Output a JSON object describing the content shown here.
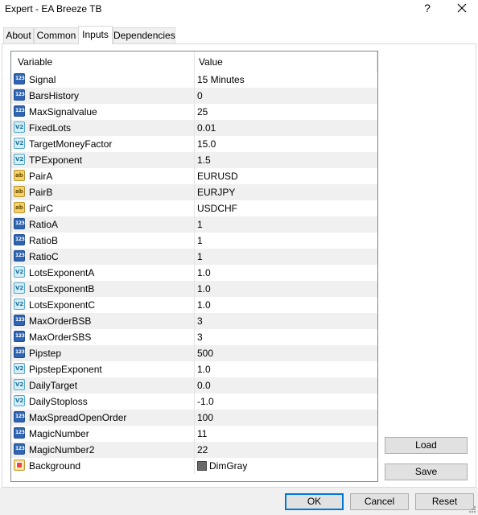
{
  "window": {
    "title": "Expert - EA Breeze TB",
    "help_glyph": "?"
  },
  "tabs": [
    {
      "label": "About",
      "active": false
    },
    {
      "label": "Common",
      "active": false
    },
    {
      "label": "Inputs",
      "active": true
    },
    {
      "label": "Dependencies",
      "active": false
    }
  ],
  "grid": {
    "columns": {
      "variable": "Variable",
      "value": "Value"
    },
    "rows": [
      {
        "type": "int",
        "icon": "int-type-icon",
        "name": "Signal",
        "value": "15 Minutes"
      },
      {
        "type": "int",
        "icon": "int-type-icon",
        "name": "BarsHistory",
        "value": "0"
      },
      {
        "type": "int",
        "icon": "int-type-icon",
        "name": "MaxSignalvalue",
        "value": "25"
      },
      {
        "type": "double",
        "icon": "double-type-icon",
        "name": "FixedLots",
        "value": "0.01"
      },
      {
        "type": "double",
        "icon": "double-type-icon",
        "name": "TargetMoneyFactor",
        "value": "15.0"
      },
      {
        "type": "double",
        "icon": "double-type-icon",
        "name": "TPExponent",
        "value": "1.5"
      },
      {
        "type": "string",
        "icon": "string-type-icon",
        "name": "PairA",
        "value": "EURUSD"
      },
      {
        "type": "string",
        "icon": "string-type-icon",
        "name": "PairB",
        "value": "EURJPY"
      },
      {
        "type": "string",
        "icon": "string-type-icon",
        "name": "PairC",
        "value": "USDCHF"
      },
      {
        "type": "int",
        "icon": "int-type-icon",
        "name": "RatioA",
        "value": "1"
      },
      {
        "type": "int",
        "icon": "int-type-icon",
        "name": "RatioB",
        "value": "1"
      },
      {
        "type": "int",
        "icon": "int-type-icon",
        "name": "RatioC",
        "value": "1"
      },
      {
        "type": "double",
        "icon": "double-type-icon",
        "name": "LotsExponentA",
        "value": "1.0"
      },
      {
        "type": "double",
        "icon": "double-type-icon",
        "name": "LotsExponentB",
        "value": "1.0"
      },
      {
        "type": "double",
        "icon": "double-type-icon",
        "name": "LotsExponentC",
        "value": "1.0"
      },
      {
        "type": "int",
        "icon": "int-type-icon",
        "name": "MaxOrderBSB",
        "value": "3"
      },
      {
        "type": "int",
        "icon": "int-type-icon",
        "name": "MaxOrderSBS",
        "value": "3"
      },
      {
        "type": "int",
        "icon": "int-type-icon",
        "name": "Pipstep",
        "value": "500"
      },
      {
        "type": "double",
        "icon": "double-type-icon",
        "name": "PipstepExponent",
        "value": "1.0"
      },
      {
        "type": "double",
        "icon": "double-type-icon",
        "name": "DailyTarget",
        "value": "0.0"
      },
      {
        "type": "double",
        "icon": "double-type-icon",
        "name": "DailyStoploss",
        "value": "-1.0"
      },
      {
        "type": "int",
        "icon": "int-type-icon",
        "name": "MaxSpreadOpenOrder",
        "value": "100"
      },
      {
        "type": "int",
        "icon": "int-type-icon",
        "name": "MagicNumber",
        "value": "11"
      },
      {
        "type": "int",
        "icon": "int-type-icon",
        "name": "MagicNumber2",
        "value": "22"
      },
      {
        "type": "color",
        "icon": "color-type-icon",
        "name": "Background",
        "value": "DimGray",
        "swatch": "#696969"
      }
    ]
  },
  "side_buttons": {
    "load": "Load",
    "save": "Save"
  },
  "footer_buttons": {
    "ok": "OK",
    "cancel": "Cancel",
    "reset": "Reset"
  },
  "type_glyphs": {
    "int": "123",
    "double": "V2",
    "string": "ab"
  },
  "colors": {
    "accent": "#0078d7",
    "alt_row": "#f0f0f0",
    "int_icon": "#2f65b3",
    "string_icon": "#f5d36a",
    "double_icon": "#d2eef8"
  }
}
